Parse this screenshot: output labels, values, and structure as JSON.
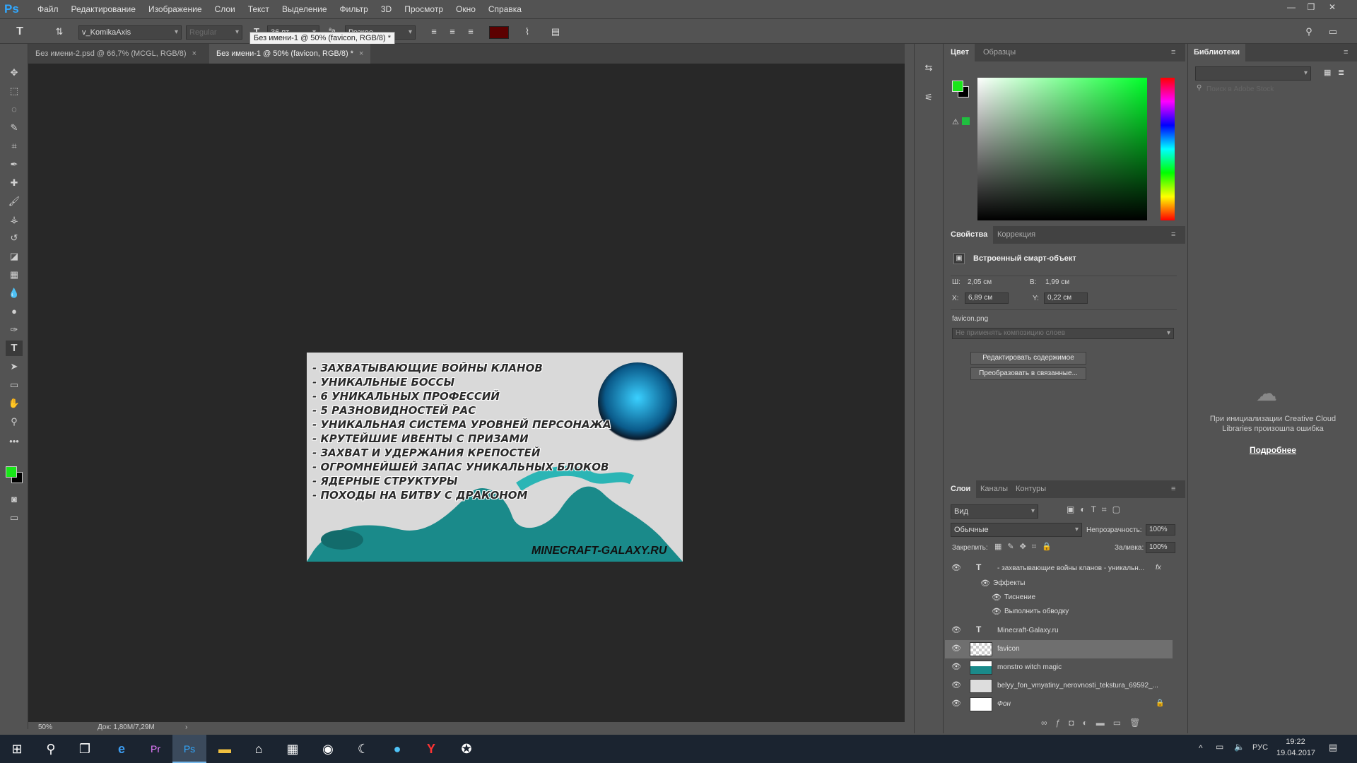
{
  "app": {
    "logo": "Ps"
  },
  "menu": [
    "Файл",
    "Редактирование",
    "Изображение",
    "Слои",
    "Текст",
    "Выделение",
    "Фильтр",
    "3D",
    "Просмотр",
    "Окно",
    "Справка"
  ],
  "options": {
    "font_family": "v_KomikaAxis",
    "font_style": "Regular",
    "font_size": "36 пт",
    "aa": "Резкое"
  },
  "tooltip": "Без имени-1 @ 50% (favicon, RGB/8) *",
  "tabs": [
    {
      "label": "Без имени-2.psd @ 66,7% (MCGL, RGB/8)",
      "close": "×"
    },
    {
      "label": "Без имени-1 @ 50% (favicon, RGB/8) *",
      "close": "×"
    }
  ],
  "document": {
    "lines": [
      "- ЗАХВАТЫВАЮЩИЕ ВОЙНЫ КЛАНОВ",
      "- УНИКАЛЬНЫЕ БОССЫ",
      "- 6 УНИКАЛЬНЫХ ПРОФЕССИЙ",
      "- 5 РАЗНОВИДНОСТЕЙ РАС",
      "- УНИКАЛЬНАЯ СИСТЕМА УРОВНЕЙ ПЕРСОНАЖА",
      "- КРУТЕЙШИЕ ИВЕНТЫ С ПРИЗАМИ",
      "- ЗАХВАТ И УДЕРЖАНИЯ КРЕПОСТЕЙ",
      "- ОГРОМНЕЙШЕЙ ЗАПАС УНИКАЛЬНЫХ БЛОКОВ",
      "- ЯДЕРНЫЕ СТРУКТУРЫ",
      "- ПОХОДЫ НА БИТВУ С ДРАКОНОМ"
    ],
    "site": "MINECRAFT-GALAXY.RU"
  },
  "status": {
    "zoom": "50%",
    "doc": "Док: 1,80M/7,29M"
  },
  "color_panel": {
    "tabs": [
      "Цвет",
      "Образцы"
    ],
    "fg": "#19e619",
    "bg": "#000000"
  },
  "properties": {
    "tabs": [
      "Свойства",
      "Коррекция"
    ],
    "title": "Встроенный смарт-объект",
    "w_label": "Ш:",
    "w": "2,05 см",
    "h_label": "В:",
    "h": "1,99 см",
    "x_label": "X:",
    "x": "6,89 см",
    "y_label": "Y:",
    "y": "0,22 см",
    "file": "favicon.png",
    "comp": "Не применять композицию слоев",
    "btn_edit": "Редактировать содержимое",
    "btn_convert": "Преобразовать в связанные..."
  },
  "layers_panel": {
    "tabs": [
      "Слои",
      "Каналы",
      "Контуры"
    ],
    "filter": "Вид",
    "blend": "Обычные",
    "opacity_label": "Непрозрачность:",
    "opacity": "100%",
    "lock_label": "Закрепить:",
    "fill_label": "Заливка:",
    "fill": "100%",
    "layers": [
      {
        "name": "- захватывающие войны кланов - уникальн...",
        "type": "text",
        "fx": "fx"
      },
      {
        "name": "Эффекты",
        "type": "sub"
      },
      {
        "name": "Тиснение",
        "type": "sub2"
      },
      {
        "name": "Выполнить обводку",
        "type": "sub2"
      },
      {
        "name": "Minecraft-Galaxy.ru",
        "type": "text"
      },
      {
        "name": "favicon",
        "type": "smart",
        "selected": true
      },
      {
        "name": "monstro witch magic",
        "type": "img"
      },
      {
        "name": "belyy_fon_vmyatiny_nerovnosti_tekstura_69592_...",
        "type": "smart"
      },
      {
        "name": "Фон",
        "type": "bg"
      }
    ]
  },
  "libraries": {
    "tab": "Библиотеки",
    "search": "Поиск в Adobe Stock",
    "error": "При инициализации Creative Cloud Libraries произошла ошибка",
    "more": "Подробнее"
  },
  "taskbar": {
    "time": "19:22",
    "date": "19.04.2017",
    "lang": "РУС"
  }
}
